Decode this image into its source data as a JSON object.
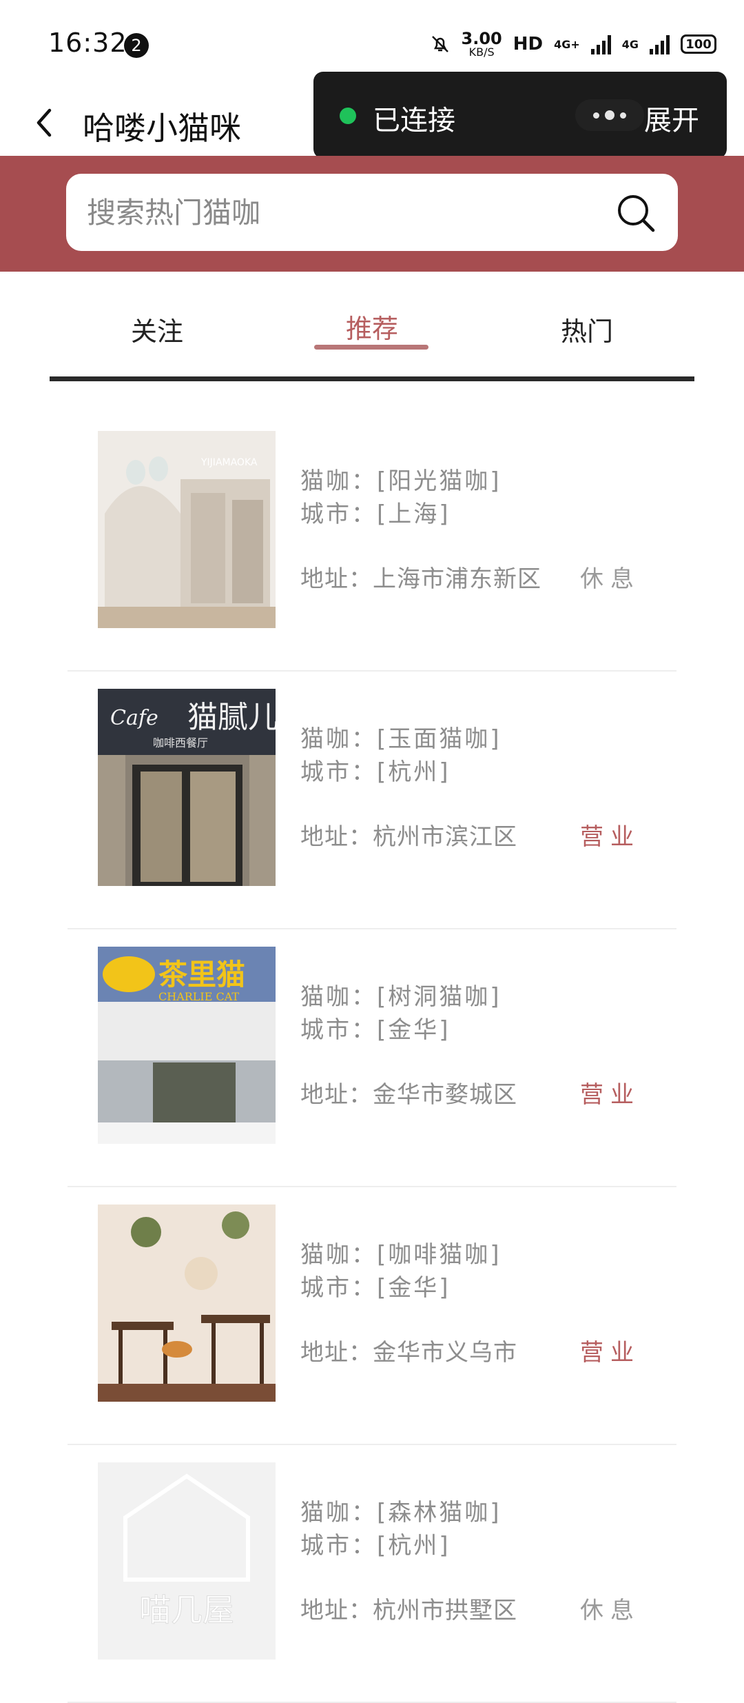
{
  "status_bar": {
    "time": "16:32",
    "notification_count": "2",
    "net_speed_value": "3.00",
    "net_speed_unit": "KB/S",
    "hd_label": "HD",
    "net_4g_plus": "4G+",
    "net_4g": "4G",
    "battery": "100"
  },
  "header": {
    "title": "哈喽小猫咪"
  },
  "connection": {
    "status_label": "已连接",
    "expand_label": "展开",
    "status_color": "#1fc25a"
  },
  "search": {
    "placeholder": "搜索热门猫咖"
  },
  "tabs": [
    {
      "label": "关注",
      "active": false
    },
    {
      "label": "推荐",
      "active": true
    },
    {
      "label": "热门",
      "active": false
    }
  ],
  "list": [
    {
      "name_line": "猫咖：[阳光猫咖]",
      "city_line": "城市：[上海]",
      "address_line": "地址：上海市浦东新区",
      "status": "休息",
      "open": false
    },
    {
      "name_line": "猫咖：[玉面猫咖]",
      "city_line": "城市：[杭州]",
      "address_line": "地址：杭州市滨江区",
      "status": "营业",
      "open": true
    },
    {
      "name_line": "猫咖：[树洞猫咖]",
      "city_line": "城市：[金华]",
      "address_line": "地址：金华市婺城区",
      "status": "营业",
      "open": true
    },
    {
      "name_line": "猫咖：[咖啡猫咖]",
      "city_line": "城市：[金华]",
      "address_line": "地址：金华市义乌市",
      "status": "营业",
      "open": true
    },
    {
      "name_line": "猫咖：[森林猫咖]",
      "city_line": "城市：[杭州]",
      "address_line": "地址：杭州市拱墅区",
      "status": "休息",
      "open": false
    }
  ],
  "thumb_text": {
    "cafe2_sign": "猫腻儿",
    "cafe2_sub": "咖啡西餐厅",
    "cafe2_script": "Cafe",
    "cafe3_sign": "茶里猫",
    "cafe3_sub": "CHARLIE CAT",
    "cafe5_sign": "喵几屋",
    "cafe1_sign": "YIJIAMAOKA"
  },
  "colors": {
    "brand": "#a64d50",
    "active_tab": "#b65e5f",
    "open_status": "#b65e5f"
  }
}
